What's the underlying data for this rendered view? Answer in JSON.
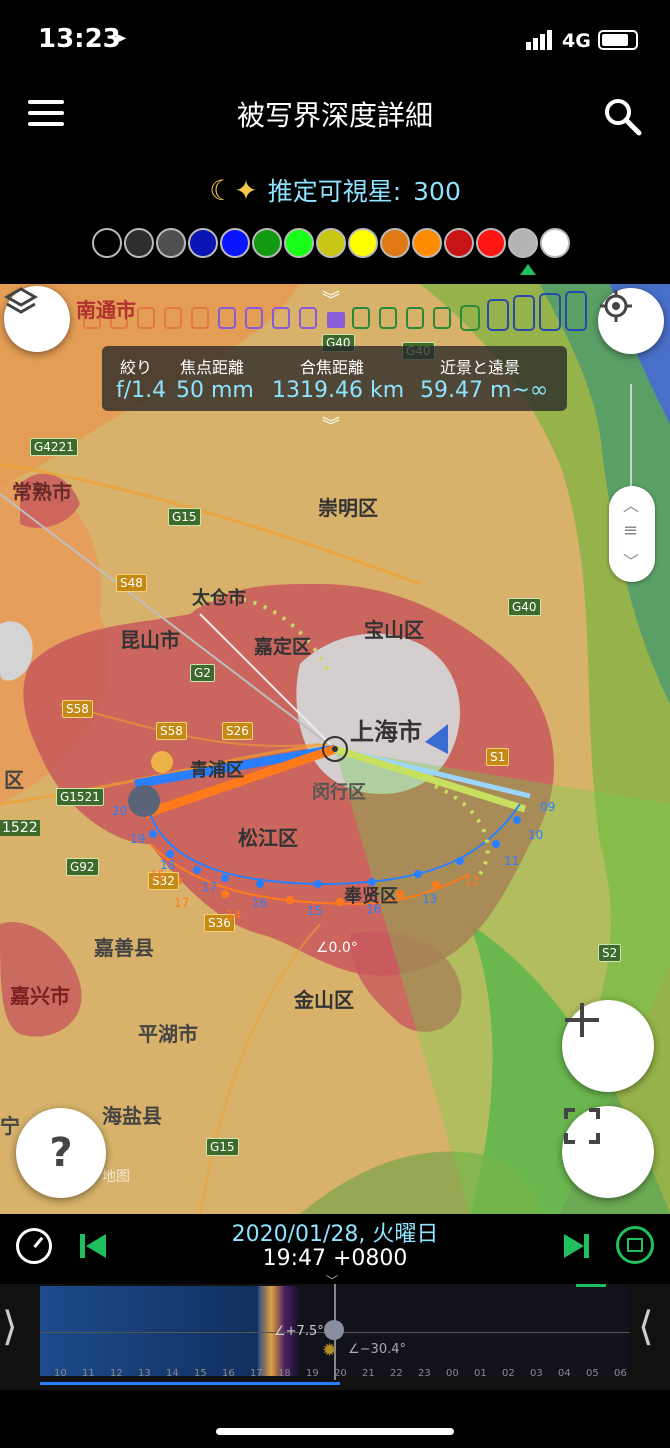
{
  "status_bar": {
    "time": "13:23",
    "network": "4G"
  },
  "header": {
    "title": "被写界深度詳細"
  },
  "stars": {
    "label": "推定可視星:",
    "value": "300"
  },
  "swatches": [
    "#000000",
    "#2e2e2e",
    "#505050",
    "#0a14b4",
    "#0a14ff",
    "#129a12",
    "#18ff18",
    "#c8c814",
    "#ffff00",
    "#e07814",
    "#ff8c00",
    "#c81414",
    "#ff1414",
    "#b4b4b4",
    "#ffffff"
  ],
  "dof": {
    "aperture_label": "絞り",
    "aperture_value": "f/1.4",
    "focal_label": "焦点距離",
    "focal_value": "50 mm",
    "focus_label": "合焦距離",
    "focus_value": "1319.46 km",
    "near_far_label": "近景と遠景",
    "near_far_value": "59.47 m~∞"
  },
  "map": {
    "places": [
      "南通市",
      "常熟市",
      "崇明区",
      "太仓市",
      "昆山市",
      "嘉定区",
      "宝山区",
      "上海市",
      "青浦区",
      "闵行区",
      "松江区",
      "奉贤区",
      "嘉善县",
      "嘉兴市",
      "金山区",
      "平湖市",
      "海盐县",
      "宁",
      "区",
      "1522"
    ],
    "roads": [
      "G4221",
      "G15",
      "S48",
      "G40",
      "G40",
      "G40",
      "G2",
      "S58",
      "S58",
      "S26",
      "G1521",
      "G92",
      "S32",
      "S36",
      "S1",
      "G15",
      "S2"
    ],
    "rise_hours": [
      "09",
      "10",
      "11",
      "12",
      "13"
    ],
    "blue_hours": [
      "15",
      "16",
      "17",
      "18",
      "19",
      "20"
    ],
    "orange_hours": [
      "14",
      "15",
      "16",
      "17"
    ],
    "angle_label": "∠0.0°",
    "watermark": "地图"
  },
  "timeline": {
    "date": "2020/01/28, 火曜日",
    "clock": "19:47 +0800",
    "moon_altitude": "∠+7.5°",
    "sun_altitude": "∠−30.4°",
    "hours": [
      "10",
      "11",
      "12",
      "13",
      "14",
      "15",
      "16",
      "17",
      "18",
      "19",
      "20",
      "21",
      "22",
      "23",
      "00",
      "01",
      "02",
      "03",
      "04",
      "05",
      "06"
    ]
  }
}
